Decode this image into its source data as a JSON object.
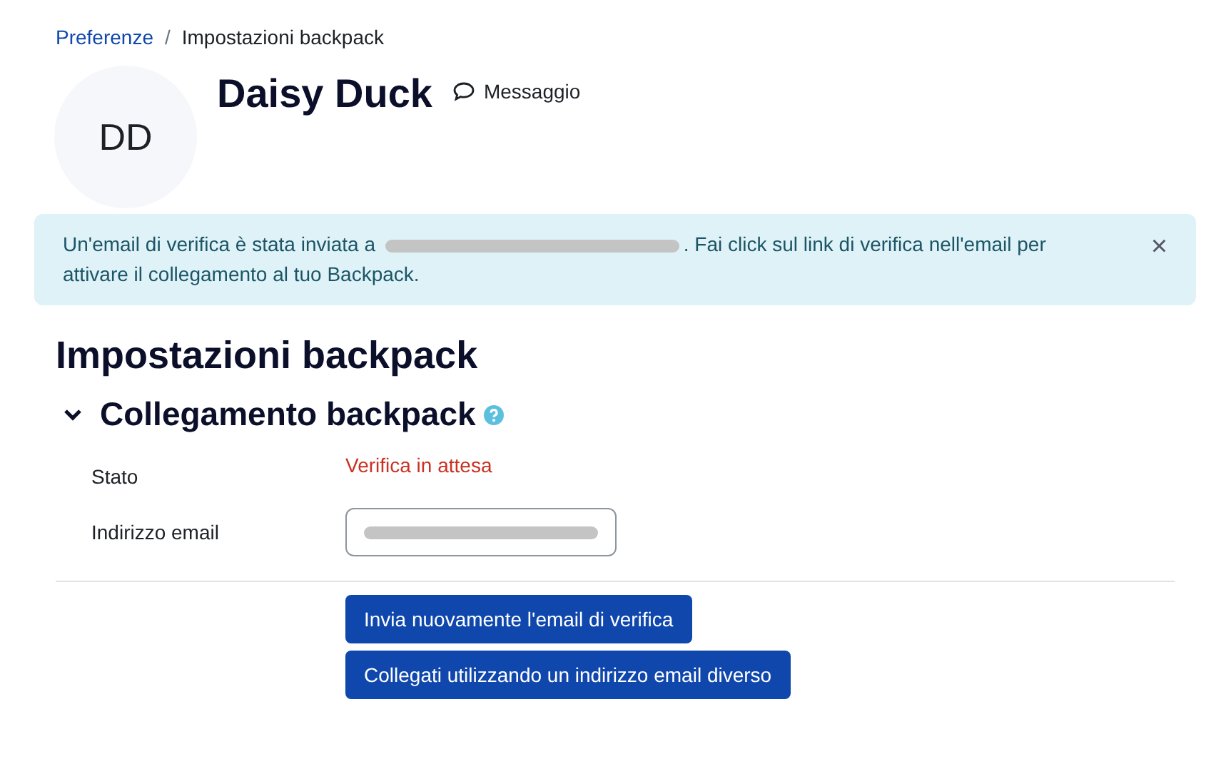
{
  "breadcrumb": [
    {
      "label": "Preferenze",
      "link": true
    },
    {
      "label": "Impostazioni backpack",
      "link": false
    }
  ],
  "breadcrumb_separator": "/",
  "profile": {
    "initials": "DD",
    "name": "Daisy Duck",
    "message_link": "Messaggio"
  },
  "alert": {
    "text_before": "Un'email di verifica è stata inviata a",
    "text_after": ". Fai click sul link di verifica nell'email per attivare il collegamento al tuo Backpack.",
    "close": "×"
  },
  "page_title": "Impostazioni backpack",
  "section": {
    "title": "Collegamento backpack",
    "expanded": true,
    "fields": [
      {
        "kind": "status",
        "label": "Stato",
        "value": "Verifica in attesa"
      },
      {
        "kind": "input",
        "label": "Indirizzo email"
      }
    ]
  },
  "buttons": [
    "Invia nuovamente l'email di verifica",
    "Collegati utilizzando un indirizzo email diverso"
  ]
}
